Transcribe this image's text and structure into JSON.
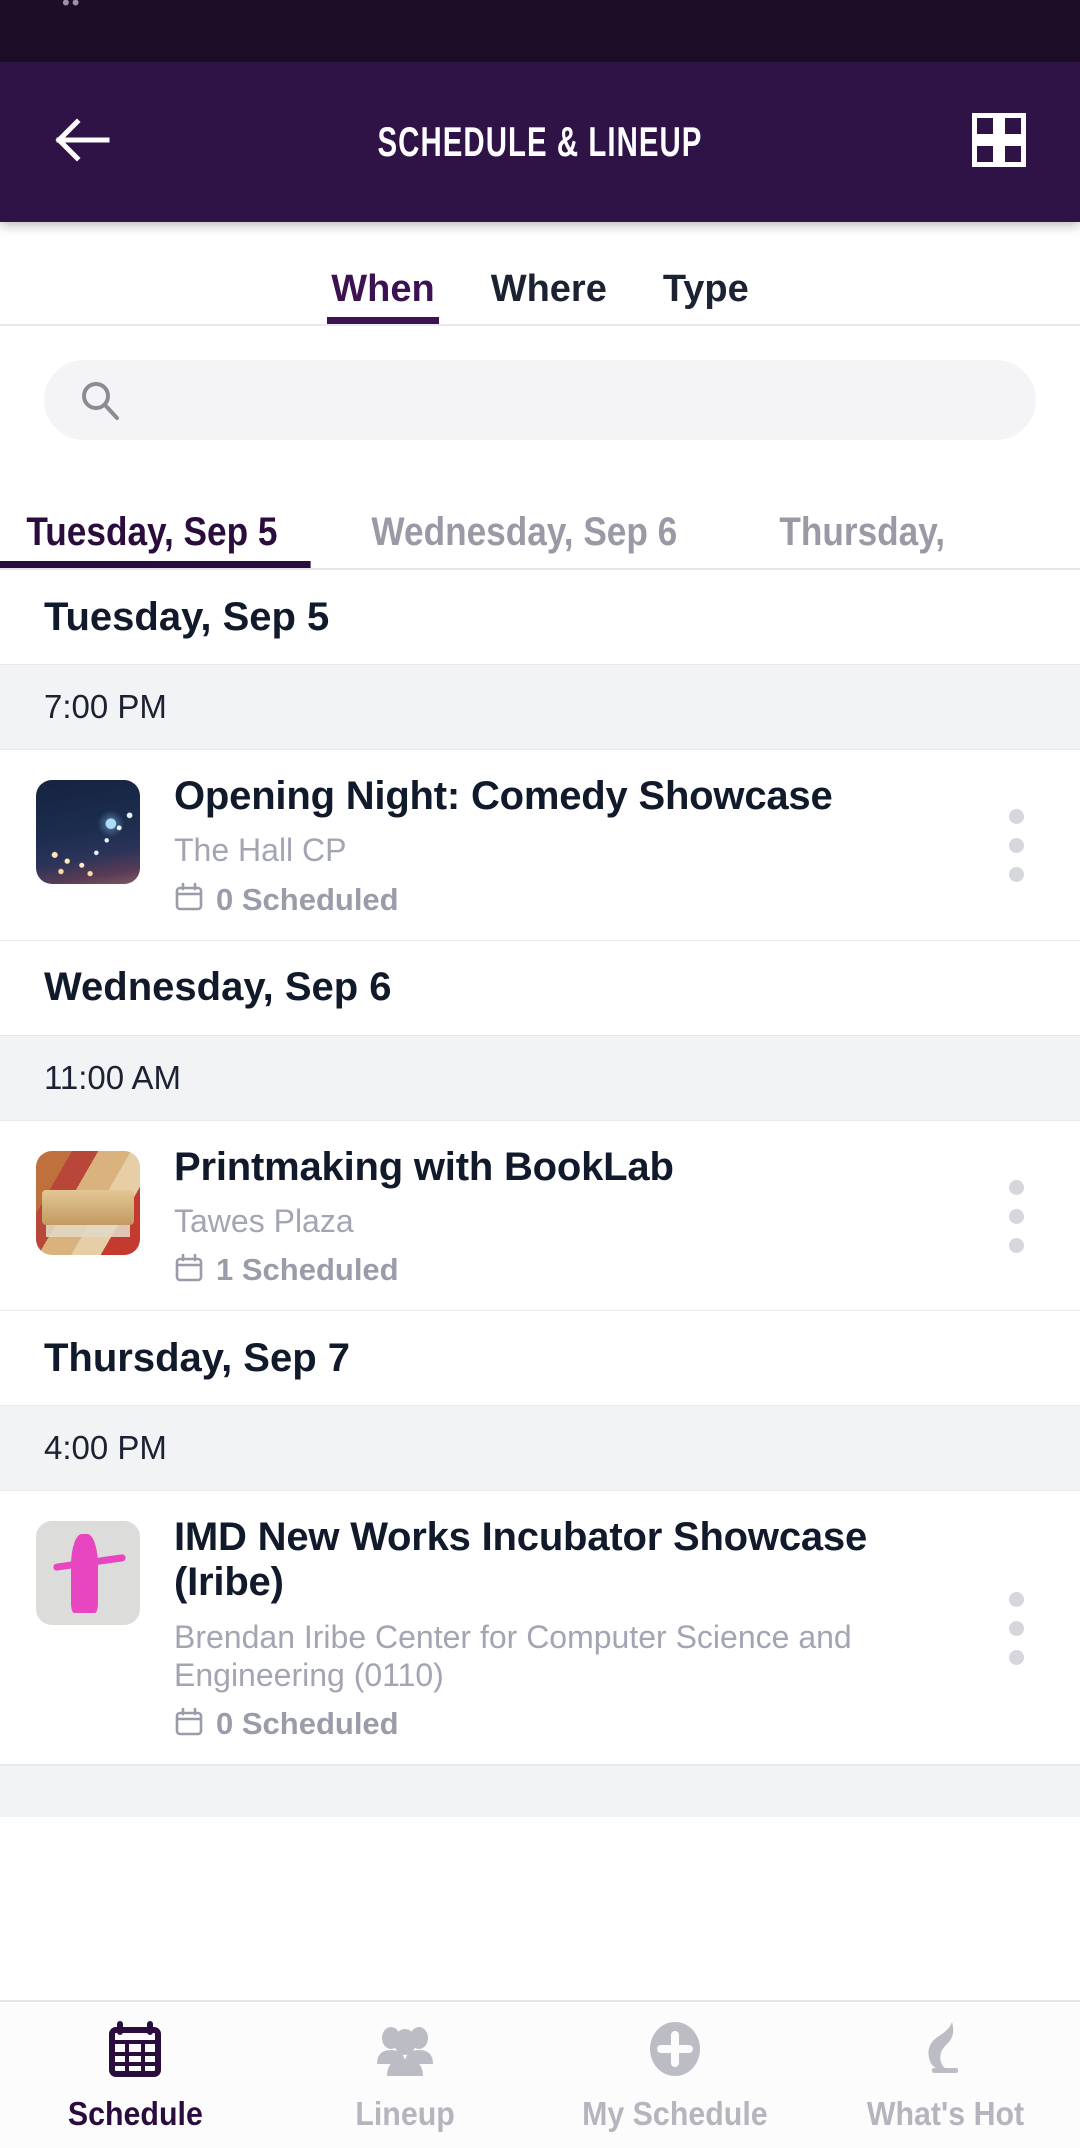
{
  "statusbar": {
    "glyph": "••"
  },
  "appbar": {
    "title": "Schedule & Lineup",
    "back_icon": "arrow-left-icon",
    "grid_icon": "grid-view-icon"
  },
  "filter_tabs": [
    {
      "label": "When",
      "active": true
    },
    {
      "label": "Where",
      "active": false
    },
    {
      "label": "Type",
      "active": false
    }
  ],
  "search": {
    "value": "",
    "placeholder": "",
    "icon": "search-icon"
  },
  "day_tabs": [
    {
      "label": "Tuesday, Sep 5",
      "active": true
    },
    {
      "label": "Wednesday, Sep 6",
      "active": false
    },
    {
      "label": "Thursday,",
      "active": false
    }
  ],
  "sections": [
    {
      "date": "Tuesday, Sep 5",
      "time": "7:00 PM",
      "event": {
        "title": "Opening Night: Comedy Showcase",
        "location": "The Hall CP",
        "scheduled": "0 Scheduled",
        "calendar_icon": "calendar-icon",
        "menu_icon": "overflow-menu-icon",
        "thumb": "night-string-lights"
      }
    },
    {
      "date": "Wednesday, Sep 6",
      "time": "11:00 AM",
      "event": {
        "title": "Printmaking with BookLab",
        "location": "Tawes Plaza",
        "scheduled": "1 Scheduled",
        "calendar_icon": "calendar-icon",
        "menu_icon": "overflow-menu-icon",
        "thumb": "printing-press"
      }
    },
    {
      "date": "Thursday, Sep 7",
      "time": "4:00 PM",
      "event": {
        "title": "IMD New Works Incubator Showcase (Iribe)",
        "location": "Brendan Iribe Center for Computer Science and Engineering (0110)",
        "scheduled": "0 Scheduled",
        "calendar_icon": "calendar-icon",
        "menu_icon": "overflow-menu-icon",
        "thumb": "magenta-dancer"
      }
    }
  ],
  "bottom_nav": [
    {
      "label": "Schedule",
      "icon": "calendar-icon",
      "active": true
    },
    {
      "label": "Lineup",
      "icon": "people-icon",
      "active": false
    },
    {
      "label": "My Schedule",
      "icon": "plus-circle-icon",
      "active": false
    },
    {
      "label": "What's Hot",
      "icon": "flame-icon",
      "active": false
    }
  ],
  "colors": {
    "status_bar": "#1e0d27",
    "app_bar": "#2f1246",
    "accent_purple": "#3c1252",
    "text_dark": "#111a2b",
    "text_muted": "#a3a5b2",
    "row_gray": "#f2f3f5",
    "search_bg": "#f4f4f6"
  }
}
